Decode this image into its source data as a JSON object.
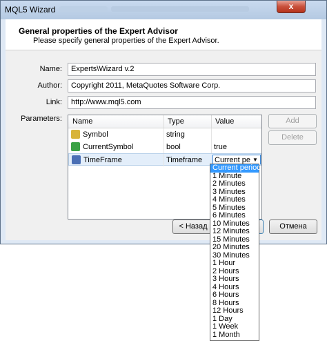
{
  "window": {
    "title": "MQL5 Wizard",
    "close_glyph": "x"
  },
  "header": {
    "title": "General properties of the Expert Advisor",
    "subtitle": "Please specify general properties of the Expert Advisor."
  },
  "form": {
    "name_label": "Name:",
    "name_value": "Experts\\Wizard v.2",
    "author_label": "Author:",
    "author_value": "Copyright 2011, MetaQuotes Software Corp.",
    "link_label": "Link:",
    "link_value": "http://www.mql5.com",
    "params_label": "Parameters:"
  },
  "params": {
    "columns": [
      "Name",
      "Type",
      "Value"
    ],
    "rows": [
      {
        "name": "Symbol",
        "type": "string",
        "value": "",
        "icon": "abc-string-icon",
        "icon_color": "#c9a227"
      },
      {
        "name": "CurrentSymbol",
        "type": "bool",
        "value": "true",
        "icon": "bool-icon",
        "icon_color": "#3aa245"
      },
      {
        "name": "TimeFrame",
        "type": "Timeframe",
        "value": "Current peri",
        "icon": "enum-list-icon",
        "icon_color": "#4a6fb5"
      }
    ],
    "add_label": "Add",
    "delete_label": "Delete"
  },
  "timeframe_options": [
    "Current period",
    "1 Minute",
    "2 Minutes",
    "3 Minutes",
    "4 Minutes",
    "5 Minutes",
    "6 Minutes",
    "10 Minutes",
    "12 Minutes",
    "15 Minutes",
    "20 Minutes",
    "30 Minutes",
    "1 Hour",
    "2 Hours",
    "3 Hours",
    "4 Hours",
    "6 Hours",
    "8 Hours",
    "12 Hours",
    "1 Day",
    "1 Week",
    "1 Month"
  ],
  "footer": {
    "back_label": "< Назад",
    "cancel_label": "Отмена"
  },
  "colors": {
    "selection": "#3399ff",
    "titlebar": "#b4c9e2"
  }
}
